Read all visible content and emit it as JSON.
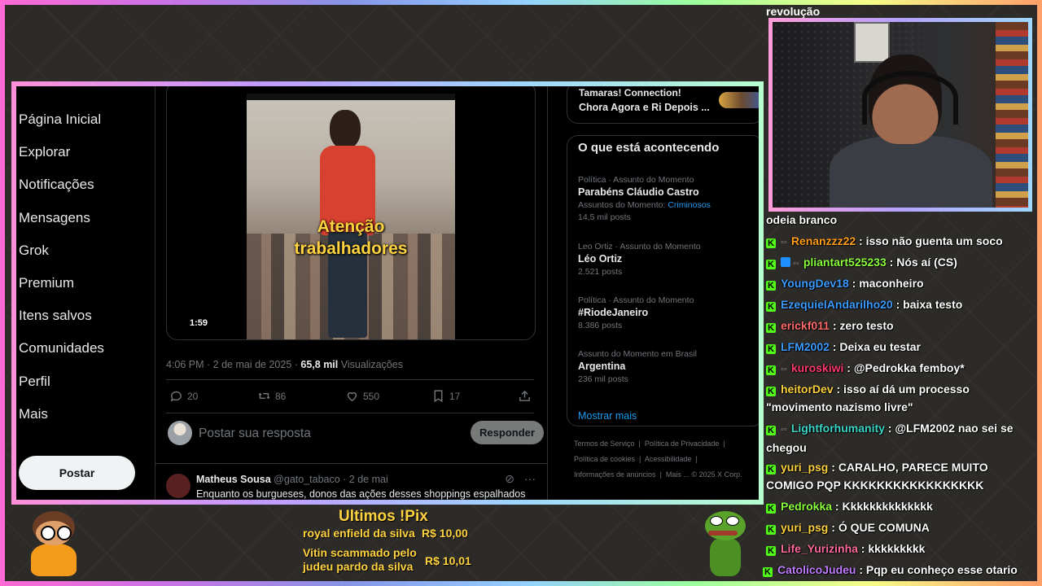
{
  "nav": {
    "items": [
      "Página Inicial",
      "Explorar",
      "Notificações",
      "Mensagens",
      "Grok",
      "Premium",
      "Itens salvos",
      "Comunidades",
      "Perfil",
      "Mais"
    ],
    "post_button": "Postar"
  },
  "tweet": {
    "video_caption_line1": "Atenção",
    "video_caption_line2": "trabalhadores",
    "video_duration": "1:59",
    "time": "4:06 PM",
    "date": "2 de mai de 2025",
    "views_count": "65,8 mil",
    "views_label": "Visualizações",
    "replies": "20",
    "reposts": "86",
    "likes": "550",
    "bookmarks": "17"
  },
  "reply": {
    "placeholder": "Postar sua resposta",
    "button": "Responder"
  },
  "next_tweet": {
    "name": "Matheus Sousa",
    "handle": "@gato_tabaco",
    "date": "2 de mai",
    "text": "Enquanto os burgueses, donos das ações desses shoppings espalhados"
  },
  "right_column": {
    "prev_card_line1": "Tamaras! Connection!",
    "prev_card_line2": "Chora Agora e Ri Depois ...",
    "trends_title": "O que está acontecendo",
    "trends": [
      {
        "context": "Política · Assunto do Momento",
        "name": "Parabéns Cláudio Castro",
        "related_label": "Assuntos do Momento:",
        "related_link": "Criminosos",
        "posts": "14,5 mil posts"
      },
      {
        "context": "Leo Ortiz · Assunto do Momento",
        "name": "Léo Ortiz",
        "posts": "2.521 posts"
      },
      {
        "context": "Política · Assunto do Momento",
        "name": "#RiodeJaneiro",
        "posts": "8.386 posts"
      },
      {
        "context": "Assunto do Momento em Brasil",
        "name": "Argentina",
        "posts": "236 mil posts"
      }
    ],
    "show_more": "Mostrar mais",
    "footer": [
      "Termos de Serviço",
      "Política de Privacidade",
      "Política de cookies",
      "Acessibilidade",
      "Informações de anúncios",
      "Mais ...",
      "© 2025 X Corp."
    ]
  },
  "chat": {
    "cut_top": "confrontos com a polícia, viva a grande revolução",
    "cut_line": "odeia branco",
    "messages": [
      {
        "user": "Renanzzz22",
        "color": "#ff9f1a",
        "text": "isso não guenta um soco",
        "badges": "dots"
      },
      {
        "user": "pliantart525233",
        "color": "#8cff3c",
        "text": "Nós aí (CS)",
        "badges": "x-dots"
      },
      {
        "user": "YoungDev18",
        "color": "#3c9bff",
        "text": "maconheiro",
        "badges": ""
      },
      {
        "user": "EzequielAndarilho20",
        "color": "#3c9bff",
        "text": "baixa testo",
        "badges": ""
      },
      {
        "user": "erickf011",
        "color": "#ff6b6b",
        "text": "zero testo",
        "badges": ""
      },
      {
        "user": "LFM2002",
        "color": "#3c9bff",
        "text": "Deixa eu testar",
        "badges": ""
      },
      {
        "user": "kuroskiwi",
        "color": "#ff3c6e",
        "text": "@Pedrokka femboy*",
        "badges": "dots"
      },
      {
        "user": "heitorDev",
        "color": "#ffd23f",
        "text": "isso aí dá um processo \"movimento nazismo livre\"",
        "badges": ""
      },
      {
        "user": "Lightforhumanity",
        "color": "#3cd6c8",
        "text": "@LFM2002 nao sei se chegou",
        "badges": "dots"
      },
      {
        "user": "yuri_psg",
        "color": "#ffd23f",
        "text": "CARALHO, PARECE MUITO COMIGO PQP KKKKKKKKKKKKKKKKK",
        "badges": ""
      },
      {
        "user": "Pedrokka",
        "color": "#8cff3c",
        "text": "Kkkkkkkkkkkkkk",
        "badges": ""
      },
      {
        "user": "yuri_psg",
        "color": "#ffd23f",
        "text": "Ó QUE COMUNA",
        "badges": ""
      },
      {
        "user": "Life_Yurizinha",
        "color": "#ff6b9b",
        "text": "kkkkkkkkk",
        "badges": ""
      },
      {
        "user": "CatolicoJudeu",
        "color": "#c07cff",
        "text": "Pqp eu conheço esse otario",
        "badges": ""
      }
    ]
  },
  "pix": {
    "title": "Ultimos !Pix",
    "entries": [
      {
        "name": "royal enfield da silva",
        "amount": "R$ 10,00"
      },
      {
        "name_line1": "Vitin scammado pelo",
        "name_line2": "judeu pardo da silva",
        "amount": "R$ 10,01"
      }
    ]
  },
  "colors": {
    "accent_blue": "#1d9bf0",
    "kick_green": "#53fc18",
    "pix_yellow": "#ffd23f"
  }
}
